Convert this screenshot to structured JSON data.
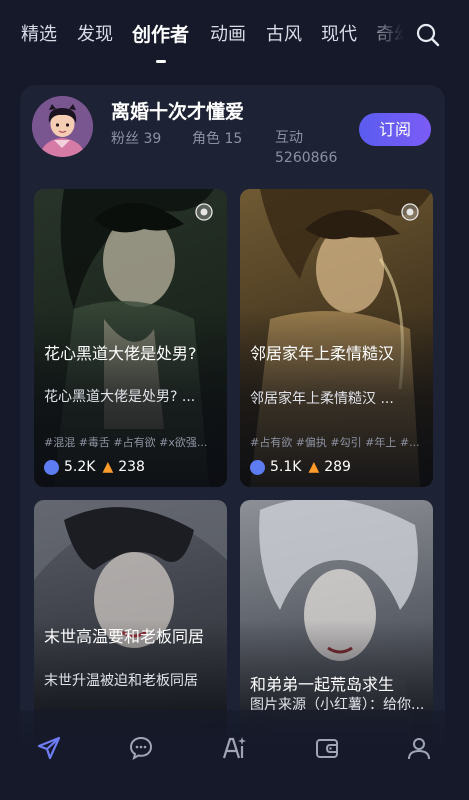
{
  "tabs": [
    "精选",
    "发现",
    "创作者",
    "动画",
    "古风",
    "现代",
    "奇幻"
  ],
  "active_tab": "创作者",
  "creator": {
    "name": "离婚十次才懂爱",
    "fans_label": "粉丝 39",
    "roles_label": "角色 15",
    "interact_label": "互动",
    "interact_value": "5260866",
    "subscribe_label": "订阅"
  },
  "cards": [
    {
      "title": "花心黑道大佬是处男?",
      "desc": "花心黑道大佬是处男? ...",
      "tags": "#混混 #毒舌 #占有欲 #x欲强...",
      "chats": "5.2K",
      "hot": "238"
    },
    {
      "title": "邻居家年上柔情糙汉",
      "desc": "邻居家年上柔情糙汉 ...",
      "tags": "#占有欲 #偏执 #勾引 #年上 #...",
      "chats": "5.1K",
      "hot": "289"
    },
    {
      "title": "末世高温要和老板同居",
      "desc": "末世升温被迫和老板同居"
    },
    {
      "title": "和弟弟一起荒岛求生",
      "desc": "图片来源（小红薯）：给你..."
    }
  ],
  "nav": [
    "send-icon",
    "chat-icon",
    "ai-icon",
    "wallet-icon",
    "profile-icon"
  ]
}
